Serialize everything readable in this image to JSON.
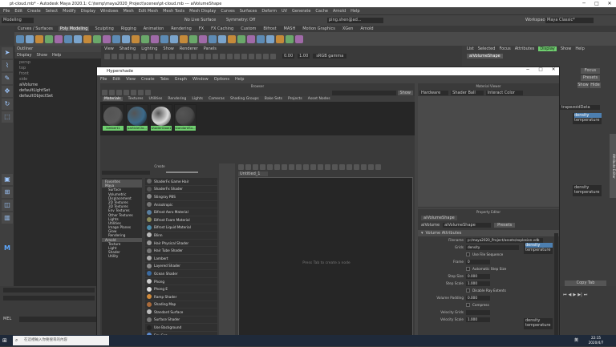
{
  "app": {
    "title": "pt-cloud.mb* - Autodesk Maya 2020.1: C:\\temp\\maya2020_Project\\scenes\\pt-cloud.mb --- aiVolumeShape",
    "menus": [
      "File",
      "Edit",
      "Create",
      "Select",
      "Modify",
      "Display",
      "Windows",
      "Mesh",
      "Edit Mesh",
      "Mesh Tools",
      "Mesh Display",
      "Curves",
      "Surfaces",
      "Deform",
      "UV",
      "Generate",
      "Cache",
      "Arnold",
      "Help"
    ],
    "workspace_label": "Workspace:",
    "workspace_value": "Maya Classic*",
    "mode_value": "Modeling",
    "live_surface": "No Live Surface",
    "symmetry": "Symmetry: Off",
    "user": "ping.shen@ad...",
    "icons": [
      "minimize-icon",
      "maximize-icon",
      "close-icon"
    ]
  },
  "shelf": {
    "tabs": [
      "Curves / Surfaces",
      "Poly Modeling",
      "Sculpting",
      "Rigging",
      "Animation",
      "Rendering",
      "FX",
      "FX Caching",
      "Custom",
      "Bifrost",
      "MASH",
      "Motion Graphics",
      "XGen",
      "Arnold"
    ],
    "active_tab": "Poly Modeling"
  },
  "outliner": {
    "title": "Outliner",
    "menu": [
      "Display",
      "Show",
      "Help"
    ],
    "items": [
      "persp",
      "top",
      "front",
      "side",
      "aiVolume",
      "defaultLightSet",
      "defaultObjectSet"
    ]
  },
  "viewport": {
    "menu": [
      "View",
      "Shading",
      "Lighting",
      "Show",
      "Renderer",
      "Panels"
    ],
    "value1": "0.00",
    "value2": "1.00",
    "colorspace": "sRGB gamma"
  },
  "attr_editor_top": {
    "menu": [
      "List",
      "Selected",
      "Focus",
      "Attributes",
      "Display",
      "Show",
      "Help"
    ],
    "active": "Display",
    "node": "aiVolumeShape",
    "buttons": [
      "Focus",
      "Presets",
      "Show",
      "Hide"
    ],
    "fields": [
      "trapezoidData",
      "density",
      "temperature",
      "density",
      "temperature"
    ],
    "copy_tab": "Copy Tab",
    "channel_box": "Attribute Editor"
  },
  "hypershade": {
    "title": "Hypershade",
    "menu": [
      "File",
      "Edit",
      "View",
      "Create",
      "Tabs",
      "Graph",
      "Window",
      "Options",
      "Help"
    ],
    "browser": {
      "header": "Browser",
      "search_placeholder": "",
      "show_label": "Show",
      "tabs": [
        "Materials",
        "Textures",
        "Utilities",
        "Rendering",
        "Lights",
        "Cameras",
        "Shading Groups",
        "Bake Sets",
        "Projects",
        "Asset Nodes"
      ],
      "swatches": [
        {
          "name": "lambert1",
          "color": "#5a5a5a"
        },
        {
          "name": "particleClo...",
          "color": "#3c6a8a"
        },
        {
          "name": "shaderGlow1",
          "color": "#dddddd"
        },
        {
          "name": "standardSu...",
          "color": "#4a4a4a"
        }
      ]
    },
    "material_viewer": {
      "header": "Material Viewer",
      "renderer": "Hardware",
      "shape": "Shader Ball",
      "color": "Interact Color"
    },
    "create": {
      "header": "Create",
      "tree": [
        {
          "label": "Favorites",
          "hdr": true
        },
        {
          "label": "Maya",
          "hdr": true
        },
        {
          "label": "Surface"
        },
        {
          "label": "Volumetric"
        },
        {
          "label": "Displacement"
        },
        {
          "label": "2D Textures"
        },
        {
          "label": "3D Textures"
        },
        {
          "label": "Env Textures"
        },
        {
          "label": "Other Textures"
        },
        {
          "label": "Lights"
        },
        {
          "label": "Utilities"
        },
        {
          "label": "Image Planes"
        },
        {
          "label": "Glow"
        },
        {
          "label": "Rendering"
        },
        {
          "label": "Arnold",
          "hdr": true
        },
        {
          "label": "Texture"
        },
        {
          "label": "Light"
        },
        {
          "label": "Shader"
        },
        {
          "label": "Utility"
        }
      ],
      "nodes": [
        "ShaderFx Game Hair",
        "ShaderFx Shader",
        "Stingray PBS",
        "Anisotropic",
        "Bifrost Aero Material",
        "Bifrost Foam Material",
        "Bifrost Liquid Material",
        "Blinn",
        "Hair Physical Shader",
        "Hair Tube Shader",
        "Lambert",
        "Layered Shader",
        "Ocean Shader",
        "Phong",
        "Phong E",
        "Ramp Shader",
        "Shading Map",
        "Standard Surface",
        "Surface Shader",
        "Use Background",
        "Env Fog"
      ]
    },
    "graph": {
      "tab": "Untitled_1",
      "hint": "Press Tab to create a node"
    },
    "property": {
      "header": "Property Editor",
      "node": "aiVolumeShape",
      "label": "aiVolume",
      "presets": "Presets",
      "section": "Volume Attributes",
      "rows": [
        {
          "label": "Filename",
          "value": "p:/maya2020_Project/assets/explosion.vdb"
        },
        {
          "label": "Grids",
          "value": "density"
        },
        {
          "label": "",
          "value": "Use File Sequence",
          "check": true
        },
        {
          "label": "Frame",
          "value": "0"
        },
        {
          "label": "",
          "value": "Automatic Step Size",
          "check": true
        },
        {
          "label": "Step Size",
          "value": "0.000"
        },
        {
          "label": "Step Scale",
          "value": "1.000"
        },
        {
          "label": "",
          "value": "Disable Ray Extents",
          "check": true
        },
        {
          "label": "Volume Padding",
          "value": "0.000"
        },
        {
          "label": "",
          "value": "Compress",
          "check": true
        },
        {
          "label": "Velocity Grids",
          "value": ""
        },
        {
          "label": "Velocity Scale",
          "value": "1.000"
        }
      ],
      "grid_list": [
        "density",
        "temperature"
      ],
      "velocity_list": [
        "density",
        "temperature"
      ]
    }
  },
  "timeslider": {
    "mel_label": "MEL"
  },
  "taskbar": {
    "search_placeholder": "在這裡輸入你要搜尋的內容",
    "time": "22:15",
    "date": "2020/4/7",
    "lang": "英",
    "temp": "",
    "start_icon": "windows-start-icon"
  }
}
